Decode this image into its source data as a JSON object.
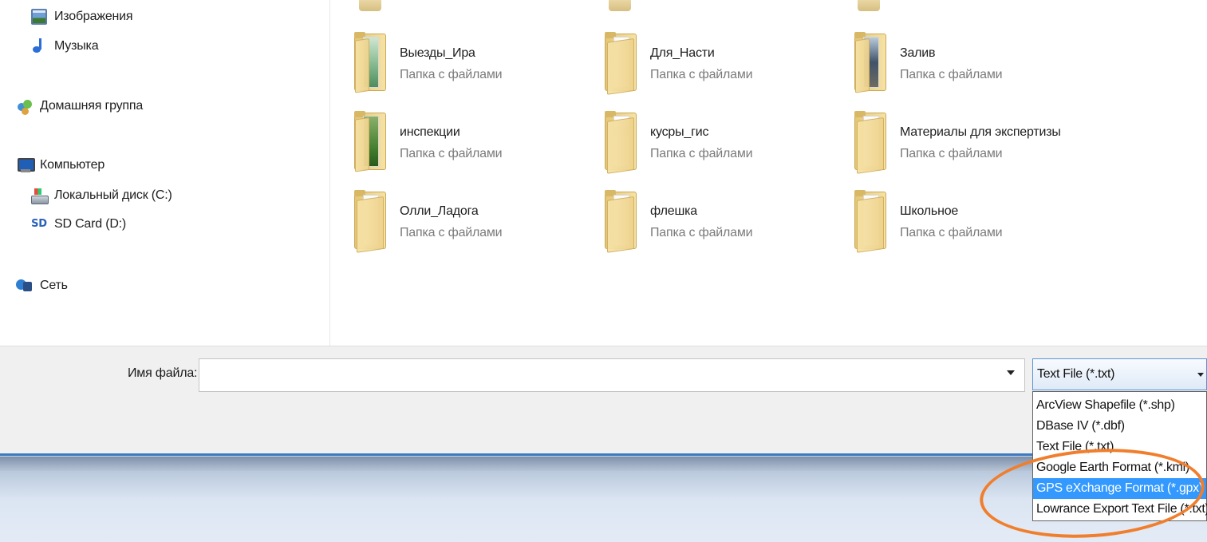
{
  "sidebar": {
    "items": [
      {
        "label": "Изображения",
        "icon": "pictures-icon"
      },
      {
        "label": "Музыка",
        "icon": "music-icon"
      },
      {
        "label": "Домашняя группа",
        "icon": "homegroup-icon"
      },
      {
        "label": "Компьютер",
        "icon": "computer-icon"
      },
      {
        "label": "Локальный диск (C:)",
        "icon": "local-disk-icon"
      },
      {
        "label": "SD Card (D:)",
        "icon": "sd-card-icon",
        "glyph": "SD"
      },
      {
        "label": "Сеть",
        "icon": "network-icon"
      }
    ]
  },
  "folders": [
    {
      "name": "Выезды_Ира",
      "type": "Папка с файлами"
    },
    {
      "name": "Для_Насти",
      "type": "Папка с файлами"
    },
    {
      "name": "Залив",
      "type": "Папка с файлами"
    },
    {
      "name": "инспекции",
      "type": "Папка с файлами"
    },
    {
      "name": "кусры_гис",
      "type": "Папка с файлами"
    },
    {
      "name": "Материалы для экспертизы",
      "type": "Папка с файлами"
    },
    {
      "name": "Олли_Ладога",
      "type": "Папка с файлами"
    },
    {
      "name": "флешка",
      "type": "Папка с файлами"
    },
    {
      "name": "Школьное",
      "type": "Папка с файлами"
    }
  ],
  "file_name": {
    "label": "Имя файла:",
    "value": ""
  },
  "file_type": {
    "selected": "Text File (*.txt)",
    "options": [
      "ArcView Shapefile (*.shp)",
      "DBase IV (*.dbf)",
      "Text File (*.txt)",
      "Google Earth Format (*.kml)",
      "GPS eXchange Format (*.gpx)",
      "Lowrance Export Text File (*.txt)"
    ],
    "highlighted_option": "GPS eXchange Format (*.gpx)"
  },
  "colors": {
    "selection_blue": "#3399ff",
    "annotation_orange": "#f07e2c",
    "separator_blue": "#3e79c0"
  }
}
